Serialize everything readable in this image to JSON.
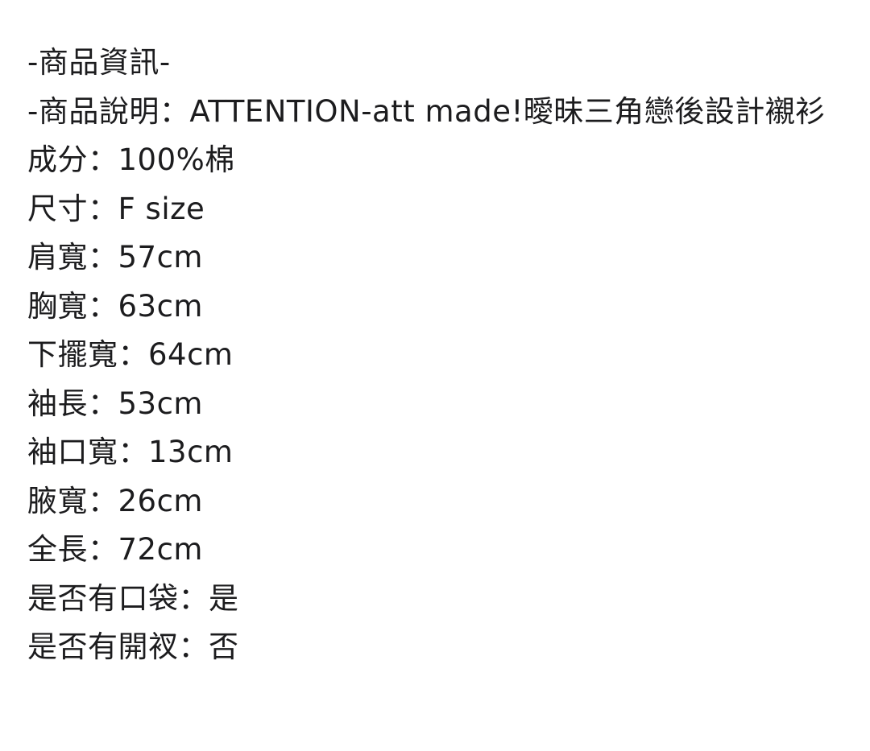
{
  "header": {
    "title": "-商品資訊-"
  },
  "description": {
    "text": "-商品說明：ATTENTION-att made!曖昧三角戀後設計襯衫"
  },
  "specs": [
    "成分：100%棉",
    "尺寸：F size",
    "肩寬：57cm",
    "胸寬：63cm",
    "下擺寬：64cm",
    "袖長：53cm",
    "袖口寬：13cm",
    "腋寬：26cm",
    "全長：72cm",
    "是否有口袋：是",
    "是否有開衩：否"
  ]
}
